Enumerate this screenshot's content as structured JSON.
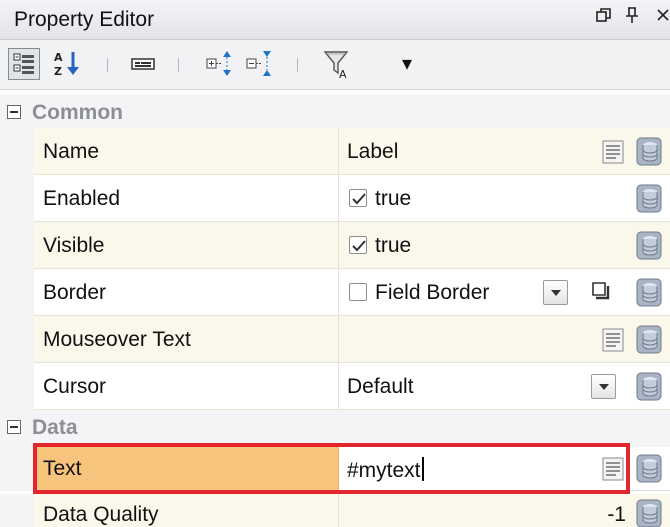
{
  "window": {
    "title": "Property Editor",
    "buttons": {
      "restore": "⎗",
      "pin": "Ф",
      "close": "×"
    }
  },
  "toolbar": {
    "dropdown_arrow": "▾",
    "icons": [
      "categorized-view-icon",
      "alphabetical-sort-icon",
      "property-pages-icon",
      "expand-all-icon",
      "collapse-all-icon",
      "filter-icon"
    ]
  },
  "categories": [
    {
      "label": "Common"
    },
    {
      "label": "Data"
    }
  ],
  "rows": {
    "name": {
      "label": "Name",
      "value": "Label"
    },
    "enabled": {
      "label": "Enabled",
      "value": "true",
      "checked": true
    },
    "visible": {
      "label": "Visible",
      "value": "true",
      "checked": true
    },
    "border": {
      "label": "Border",
      "value": "Field Border",
      "checked": false
    },
    "mouseover": {
      "label": "Mouseover Text",
      "value": ""
    },
    "cursor": {
      "label": "Cursor",
      "value": "Default"
    },
    "text": {
      "label": "Text",
      "value": "#mytext",
      "selected": true
    },
    "quality": {
      "label": "Data Quality",
      "value": "-1"
    }
  },
  "colors": {
    "selected_name_bg": "#f7c47d",
    "selection_outline": "#e2262e",
    "alt_row_bg": "#faf8ea",
    "category_text": "#8d8f93"
  }
}
